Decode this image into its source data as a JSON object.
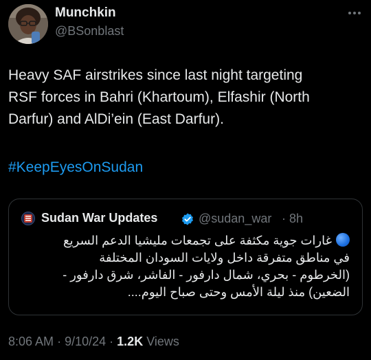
{
  "author": {
    "name": "Munchkin",
    "handle": "@BSonblast"
  },
  "tweet": {
    "lines": [
      "Heavy SAF airstrikes since last night targeting",
      "RSF forces in Bahri (Khartoum), Elfashir (North",
      "Darfur) and AlDi’ein (East Darfur)."
    ],
    "hashtag": "#KeepEyesOnSudan"
  },
  "quote": {
    "name": "Sudan War Updates",
    "handle": "@sudan_war",
    "separator": "·",
    "time": "8h",
    "avatar_text": "SUDAN WAR UPDATES",
    "lines": [
      "غارات جوية مكثفة على تجمعات مليشيا الدعم السريع",
      "في مناطق متفرقة داخل ولايات السودان المختلفة",
      "(الخرطوم - بحري، شمال دارفور - الفاشر، شرق دارفور -",
      "الضعين) منذ ليلة الأمس وحتى صباح اليوم...."
    ]
  },
  "meta": {
    "time": "8:06 AM",
    "date": "9/10/24",
    "separator": "·",
    "views_count": "1.2K",
    "views_label": "Views"
  },
  "icons": {
    "more": "more-horizontal-icon",
    "verified": "verified-badge-icon",
    "status_dot": "blue-circle-emoji"
  },
  "colors": {
    "background": "#000000",
    "text": "#e7e9ea",
    "secondary": "#71767b",
    "link": "#1d9bf0",
    "border": "#2f3336"
  }
}
